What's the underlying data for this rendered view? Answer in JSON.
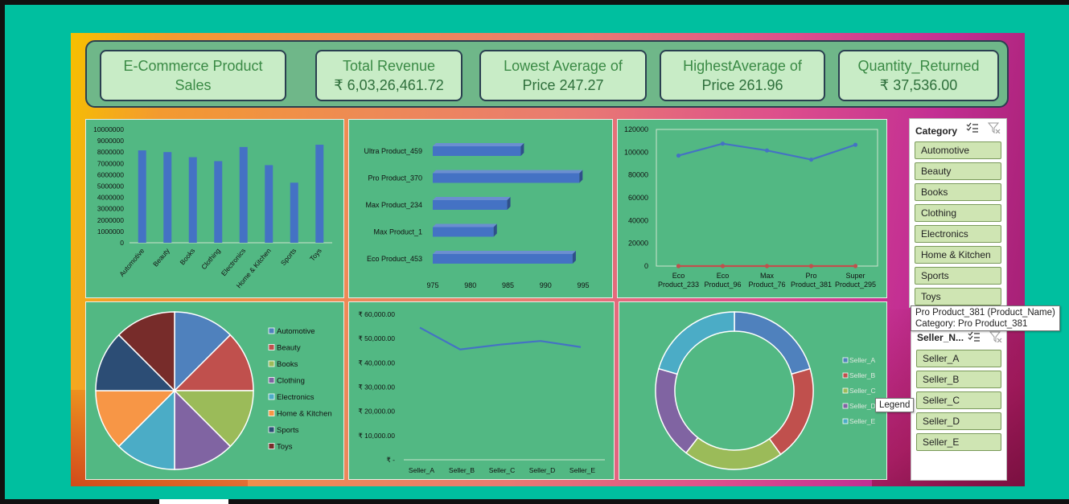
{
  "kpis": {
    "title_line1": "E-Commerce Product",
    "title_line2": "Sales",
    "revenue_label": "Total Revenue",
    "revenue_value": "₹  6,03,26,461.72",
    "lowest_label": "Lowest Average of",
    "lowest_value": "Price   247.27",
    "highest_label": "HighestAverage of",
    "highest_value": "Price  261.96",
    "returned_label": "Quantity_Returned",
    "returned_value": "₹ 37,536.00"
  },
  "chart_data": [
    {
      "id": "category-revenue",
      "type": "bar",
      "categories": [
        "Automotive",
        "Beauty",
        "Books",
        "Clothing",
        "Electronics",
        "Home & Kitchen",
        "Sports",
        "Toys"
      ],
      "values": [
        8150000,
        8000000,
        7550000,
        7200000,
        8450000,
        6850000,
        5300000,
        8650000
      ],
      "ylim": [
        0,
        10000000
      ],
      "yticks": [
        "0",
        "1000000",
        "2000000",
        "3000000",
        "4000000",
        "5000000",
        "6000000",
        "7000000",
        "8000000",
        "9000000",
        "10000000"
      ],
      "color": "#4472c4"
    },
    {
      "id": "product-hbar",
      "type": "bar",
      "orientation": "horizontal",
      "categories": [
        "Ultra Product_459",
        "Pro Product_370",
        "Max Product_234",
        "Max Product_1",
        "Eco Product_453"
      ],
      "values": [
        986.7,
        994.5,
        984.9,
        983.1,
        993.6
      ],
      "xlim": [
        975,
        995
      ],
      "xticks": [
        "975",
        "980",
        "985",
        "990",
        "995"
      ],
      "color": "#4472c4"
    },
    {
      "id": "product-line",
      "type": "line",
      "categories": [
        [
          "Eco",
          "Product_233"
        ],
        [
          "Eco",
          "Product_96"
        ],
        [
          "Max",
          "Product_76"
        ],
        [
          "Pro",
          "Product_381"
        ],
        [
          "Super",
          "Product_295"
        ]
      ],
      "series": [
        {
          "values": [
            97000,
            107500,
            101500,
            93500,
            106500
          ],
          "color": "#4472c4"
        },
        {
          "values": [
            0,
            0,
            0,
            0,
            0
          ],
          "color": "#c0504d"
        }
      ],
      "ylim": [
        0,
        120000
      ],
      "yticks": [
        "0",
        "20000",
        "40000",
        "60000",
        "80000",
        "100000",
        "120000"
      ]
    },
    {
      "id": "category-pie",
      "type": "pie",
      "labels": [
        "Automotive",
        "Beauty",
        "Books",
        "Clothing",
        "Electronics",
        "Home & Kitchen",
        "Sports",
        "Toys"
      ],
      "values": [
        12.5,
        12.5,
        12.5,
        12.5,
        12.5,
        12.5,
        12.5,
        12.5
      ],
      "colors": [
        "#4f81bd",
        "#c0504d",
        "#9bbb59",
        "#8064a2",
        "#4bacc6",
        "#f79646",
        "#2c4d75",
        "#772c2a"
      ],
      "legend": "right"
    },
    {
      "id": "seller-line",
      "type": "line",
      "categories": [
        "Seller_A",
        "Seller_B",
        "Seller_C",
        "Seller_D",
        "Seller_E"
      ],
      "values": [
        54500,
        45500,
        47500,
        49000,
        46500
      ],
      "ylim": [
        0,
        60000
      ],
      "yticks": [
        "₹ -",
        "₹ 10,000.00",
        "₹ 20,000.00",
        "₹ 30,000.00",
        "₹ 40,000.00",
        "₹ 50,000.00",
        "₹ 60,000.00"
      ],
      "color": "#4472c4"
    },
    {
      "id": "seller-donut",
      "type": "pie",
      "donut": true,
      "labels": [
        "Seller_A",
        "Seller_B",
        "Seller_C",
        "Seller_D",
        "Seller_E"
      ],
      "values": [
        20.5,
        19.5,
        20.5,
        19,
        20.5
      ],
      "colors": [
        "#4f81bd",
        "#c0504d",
        "#9bbb59",
        "#8064a2",
        "#4bacc6"
      ],
      "legend": "right"
    }
  ],
  "category_slicer": {
    "title": "Category",
    "items": [
      "Automotive",
      "Beauty",
      "Books",
      "Clothing",
      "Electronics",
      "Home & Kitchen",
      "Sports",
      "Toys"
    ]
  },
  "seller_slicer": {
    "title": "Seller_N...",
    "items": [
      "Seller_A",
      "Seller_B",
      "Seller_C",
      "Seller_D",
      "Seller_E"
    ]
  },
  "tooltips": {
    "product_line1": "Pro Product_381 (Product_Name)",
    "product_line2": "Category: Pro Product_381",
    "legend": "Legend"
  },
  "icons": {
    "multi_select": "multi-select-icon",
    "clear_filter": "clear-filter-icon"
  }
}
